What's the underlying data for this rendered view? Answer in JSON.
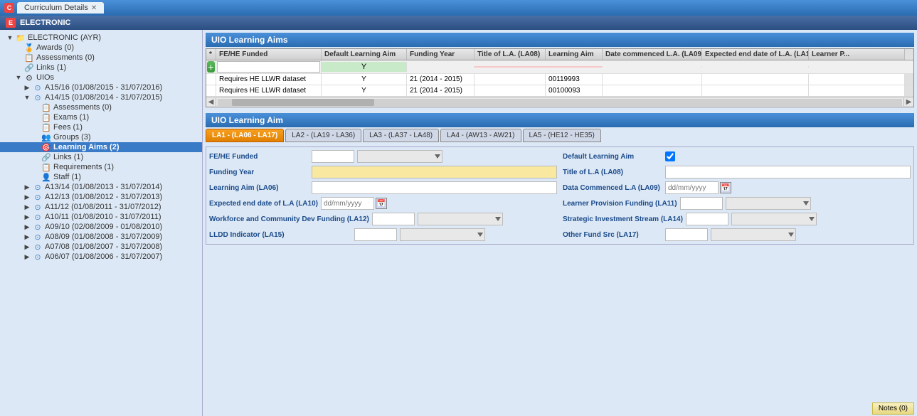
{
  "titleBar": {
    "icon": "C",
    "tabs": [
      {
        "label": "Curriculum Details",
        "active": true
      }
    ]
  },
  "sectionHeader": {
    "label": "ELECTRONIC"
  },
  "sidebar": {
    "items": [
      {
        "id": "electronic-ayr",
        "label": "ELECTRONIC (AYR)",
        "level": 1,
        "type": "folder",
        "expanded": true,
        "hasExpand": true
      },
      {
        "id": "awards",
        "label": "Awards (0)",
        "level": 2,
        "type": "item"
      },
      {
        "id": "assessments",
        "label": "Assessments (0)",
        "level": 2,
        "type": "item"
      },
      {
        "id": "links",
        "label": "Links (1)",
        "level": 2,
        "type": "item"
      },
      {
        "id": "uios",
        "label": "UIOs",
        "level": 2,
        "type": "folder",
        "expanded": true,
        "hasExpand": true
      },
      {
        "id": "a1516",
        "label": "A15/16 (01/08/2015 - 31/07/2016)",
        "level": 3,
        "type": "folder",
        "hasExpand": true
      },
      {
        "id": "a1415",
        "label": "A14/15 (01/08/2014 - 31/07/2015)",
        "level": 3,
        "type": "folder",
        "expanded": true,
        "hasExpand": true
      },
      {
        "id": "a1415-assessments",
        "label": "Assessments (0)",
        "level": 4,
        "type": "item"
      },
      {
        "id": "a1415-exams",
        "label": "Exams (1)",
        "level": 4,
        "type": "item"
      },
      {
        "id": "a1415-fees",
        "label": "Fees (1)",
        "level": 4,
        "type": "item"
      },
      {
        "id": "a1415-groups",
        "label": "Groups (3)",
        "level": 4,
        "type": "item"
      },
      {
        "id": "a1415-learning-aims",
        "label": "Learning Aims (2)",
        "level": 4,
        "type": "item",
        "selected": true
      },
      {
        "id": "a1415-links",
        "label": "Links (1)",
        "level": 4,
        "type": "item"
      },
      {
        "id": "a1415-requirements",
        "label": "Requirements (1)",
        "level": 4,
        "type": "item"
      },
      {
        "id": "a1415-staff",
        "label": "Staff (1)",
        "level": 4,
        "type": "item"
      },
      {
        "id": "a1314",
        "label": "A13/14 (01/08/2013 - 31/07/2014)",
        "level": 3,
        "type": "folder",
        "hasExpand": true
      },
      {
        "id": "a1213",
        "label": "A12/13 (01/08/2012 - 31/07/2013)",
        "level": 3,
        "type": "folder",
        "hasExpand": true
      },
      {
        "id": "a1112",
        "label": "A11/12 (01/08/2011 - 31/07/2012)",
        "level": 3,
        "type": "folder",
        "hasExpand": true
      },
      {
        "id": "a1011",
        "label": "A10/11 (01/08/2010 - 31/07/2011)",
        "level": 3,
        "type": "folder",
        "hasExpand": true
      },
      {
        "id": "a0910",
        "label": "A09/10 (02/08/2009 - 01/08/2010)",
        "level": 3,
        "type": "folder",
        "hasExpand": true
      },
      {
        "id": "a0809",
        "label": "A08/09 (01/08/2008 - 31/07/2009)",
        "level": 3,
        "type": "folder",
        "hasExpand": true
      },
      {
        "id": "a0708",
        "label": "A07/08 (01/08/2007 - 31/07/2008)",
        "level": 3,
        "type": "folder",
        "hasExpand": true
      },
      {
        "id": "a0607",
        "label": "A06/07 (01/08/2006 - 31/07/2007)",
        "level": 3,
        "type": "folder",
        "hasExpand": true
      }
    ]
  },
  "gridSection": {
    "title": "UIO Learning Aims",
    "columns": [
      {
        "id": "col-marker",
        "label": "*",
        "width": 14
      },
      {
        "id": "col-feHe",
        "label": "FE/HE Funded",
        "width": 130
      },
      {
        "id": "col-default",
        "label": "Default Learning Aim",
        "width": 120
      },
      {
        "id": "col-funding",
        "label": "Funding Year",
        "width": 90
      },
      {
        "id": "col-title",
        "label": "Title of L.A. (LA08)",
        "width": 100
      },
      {
        "id": "col-learning",
        "label": "Learning Aim",
        "width": 80
      },
      {
        "id": "col-date",
        "label": "Date commenced L.A. (LA09)",
        "width": 140
      },
      {
        "id": "col-enddate",
        "label": "Expected end date of L.A. (LA10)",
        "width": 150
      },
      {
        "id": "col-learner",
        "label": "Learner P...",
        "width": 70
      }
    ],
    "rows": [
      {
        "marker": "",
        "feHe": "Requires HE LLWR dataset",
        "default": "Y",
        "funding": "21 (2014 - 2015)",
        "title": "",
        "learning": "00119993",
        "date": "",
        "enddate": "",
        "learner": ""
      },
      {
        "marker": "",
        "feHe": "Requires HE LLWR dataset",
        "default": "Y",
        "funding": "21 (2014 - 2015)",
        "title": "",
        "learning": "00100093",
        "date": "",
        "enddate": "",
        "learner": ""
      }
    ],
    "newRow": {
      "feHePlaceholder": "",
      "defaultValue": ""
    }
  },
  "detailSection": {
    "title": "UIO Learning Aim",
    "tabs": [
      {
        "id": "la1",
        "label": "LA1 - (LA06 - LA17)",
        "active": true
      },
      {
        "id": "la2",
        "label": "LA2 - (LA19 - LA36)",
        "active": false
      },
      {
        "id": "la3",
        "label": "LA3 - (LA37 - LA48)",
        "active": false
      },
      {
        "id": "la4",
        "label": "LA4 - (AW13 - AW21)",
        "active": false
      },
      {
        "id": "la5",
        "label": "LA5 - (HE12 - HE35)",
        "active": false
      }
    ],
    "form": {
      "feHeFunded": {
        "label": "FE/HE Funded",
        "value": ""
      },
      "defaultLearningAim": {
        "label": "Default Learning Aim",
        "checked": true
      },
      "fundingYear": {
        "label": "Funding Year",
        "value": ""
      },
      "titleLA08": {
        "label": "Title of L.A (LA08)",
        "value": ""
      },
      "learningAimLA06": {
        "label": "Learning Aim (LA06)",
        "value": ""
      },
      "dataCommencedLA09": {
        "label": "Data Commenced L.A (LA09)",
        "value": "dd/mm/yyyy"
      },
      "expectedEndLA10": {
        "label": "Expected end date of L.A (LA10)",
        "value": "dd/mm/yyyy"
      },
      "learnerProvisionLA11": {
        "label": "Learner Provision Funding (LA11)",
        "value": ""
      },
      "workforceLA12": {
        "label": "Workforce and Community Dev Funding (LA12)",
        "value": ""
      },
      "strategicInvestmentLA14": {
        "label": "Strategic Investment Stream (LA14)",
        "value": ""
      },
      "llddIndicatorLA15": {
        "label": "LLDD Indicator (LA15)",
        "value": ""
      },
      "otherFundSrcLA17": {
        "label": "Other Fund Src (LA17)",
        "value": ""
      }
    }
  },
  "notesBtn": {
    "label": "Notes (0)"
  }
}
